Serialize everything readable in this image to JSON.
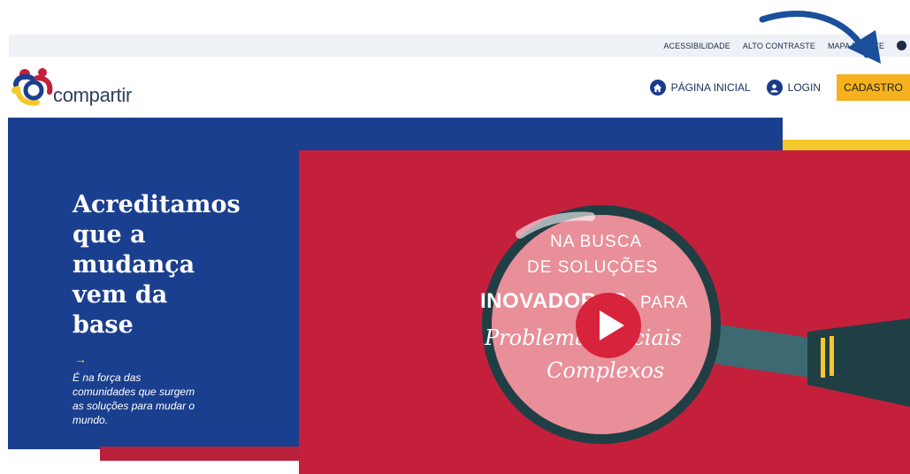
{
  "utility_bar": {
    "links": [
      "ACESSIBILIDADE",
      "ALTO CONTRASTE",
      "MAPA DO SITE"
    ]
  },
  "logo": {
    "text": "compartir"
  },
  "nav": {
    "home_label": "PÁGINA INICIAL",
    "login_label": "LOGIN",
    "signup_label": "CADASTRO"
  },
  "hero": {
    "title_lines": [
      "Acreditamos",
      "que a",
      "mudança",
      "vem da",
      "base"
    ],
    "arrow": "→",
    "subtitle_lines": [
      "É na força das",
      "comunidades que surgem",
      "as soluções para mudar o",
      "mundo."
    ]
  },
  "video": {
    "line1": "NA BUSCA",
    "line2": "DE SOLUÇÕES",
    "line3": "INOVADORAS",
    "line3b": "PARA",
    "line4": "Problemas Sociais",
    "line5": "Complexos"
  },
  "colors": {
    "brand_blue": "#1b3f8f",
    "brand_red": "#c4203b",
    "brand_yellow": "#f5c82c",
    "cta_orange": "#f6b21c"
  }
}
